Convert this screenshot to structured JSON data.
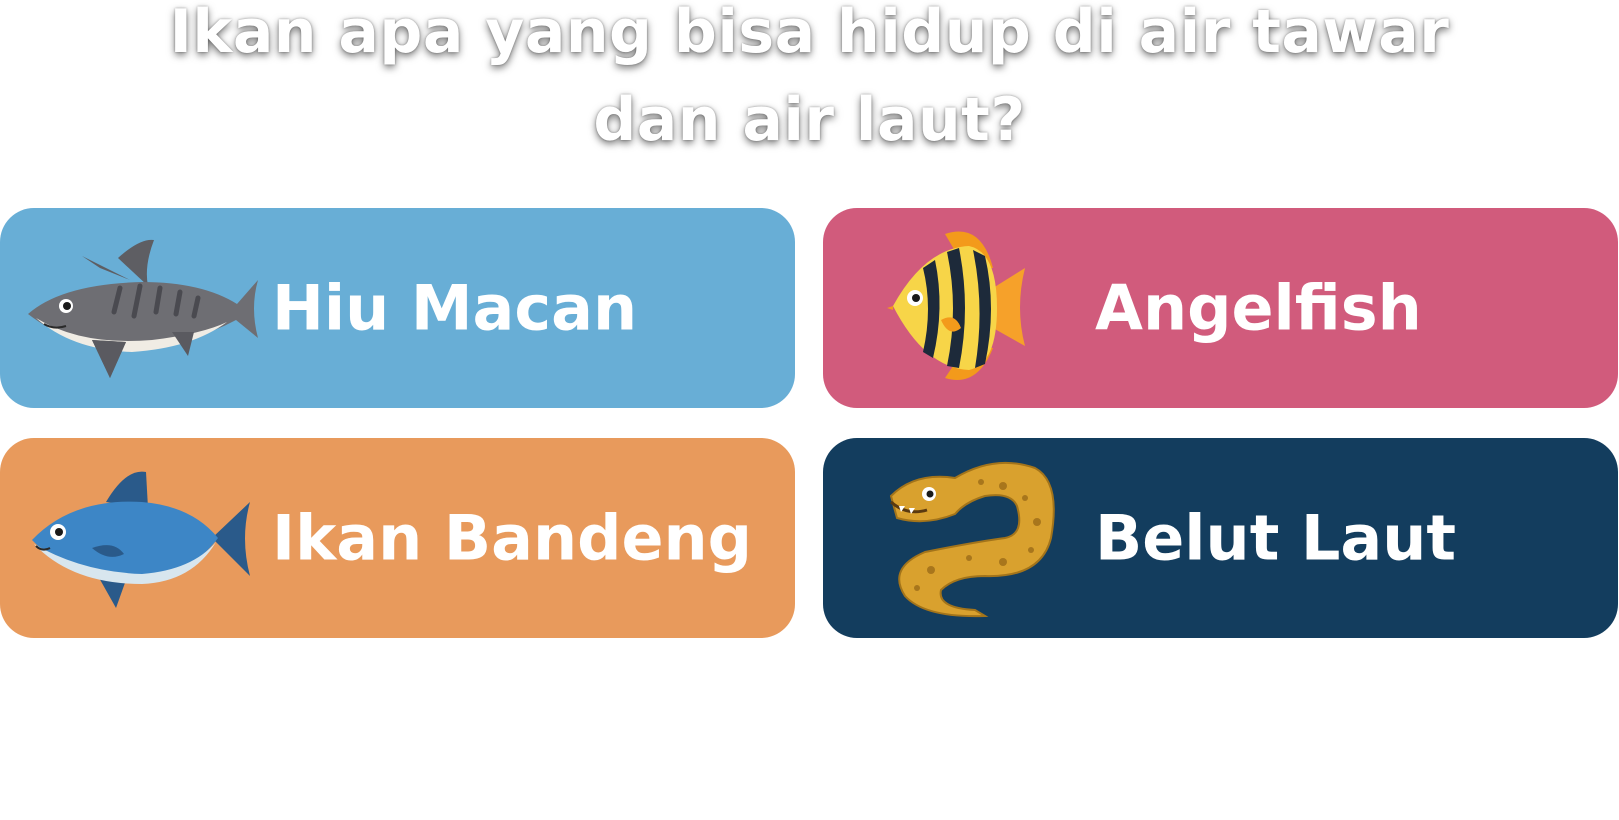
{
  "quiz": {
    "question": "Ikan apa yang bisa hidup di air tawar dan air laut?",
    "options": [
      {
        "label": "Hiu Macan",
        "color": "#68aed6",
        "icon": "tiger-shark-icon"
      },
      {
        "label": "Angelfish",
        "color": "#d15b7c",
        "icon": "angelfish-icon"
      },
      {
        "label": "Ikan Bandeng",
        "color": "#e89a5c",
        "icon": "milkfish-icon"
      },
      {
        "label": "Belut Laut",
        "color": "#133d5e",
        "icon": "moray-eel-icon"
      }
    ]
  }
}
